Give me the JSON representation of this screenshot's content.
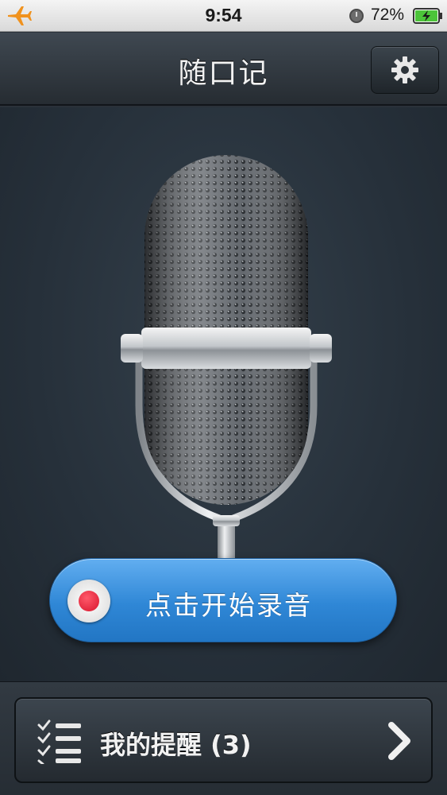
{
  "status_bar": {
    "time": "9:54",
    "battery_percent": "72%",
    "icons": [
      "airplane-icon",
      "lock-rotation-icon",
      "battery-charging-icon"
    ]
  },
  "nav": {
    "title": "随口记",
    "settings_icon": "gear-icon"
  },
  "main": {
    "record_button_label": "点击开始录音",
    "record_icon": "record-dot-icon",
    "illustration": "microphone"
  },
  "bottom": {
    "reminders_label": "我的提醒 (3)",
    "reminders_icon": "checklist-icon",
    "chevron_icon": "chevron-right-icon"
  },
  "colors": {
    "accent_blue": "#2f87d6",
    "record_red": "#d8142c",
    "background": "#2a3139",
    "airplane_orange": "#f0921e"
  }
}
